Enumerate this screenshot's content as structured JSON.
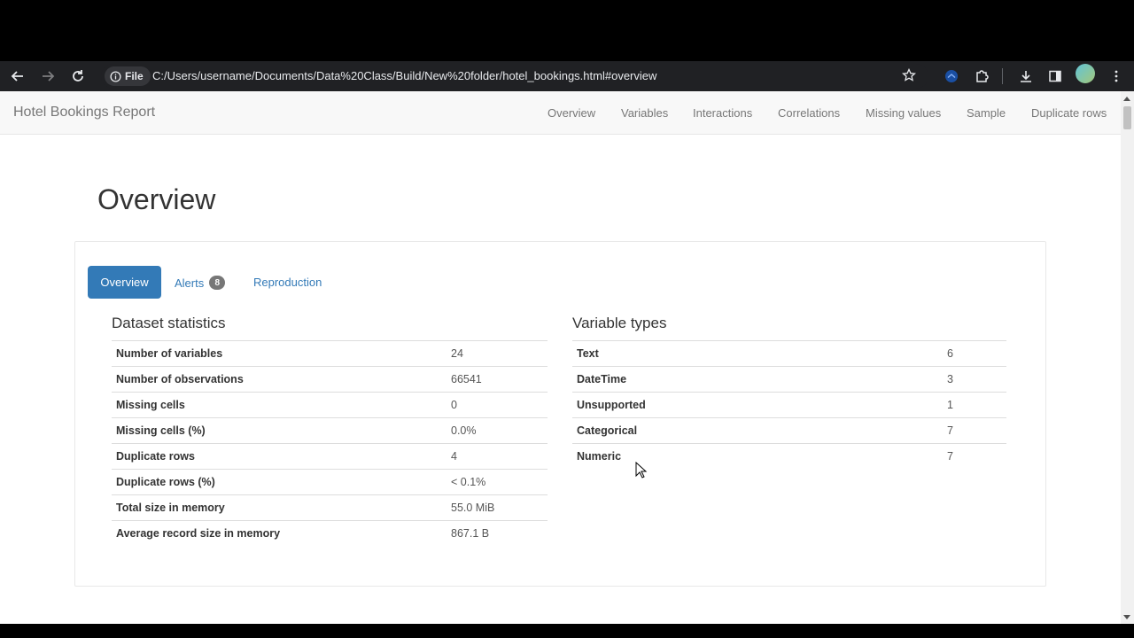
{
  "browser": {
    "file_chip_label": "File",
    "url": "C:/Users/username/Documents/Data%20Class/Build/New%20folder/hotel_bookings.html#overview"
  },
  "navbar": {
    "brand": "Hotel Bookings Report",
    "items": [
      "Overview",
      "Variables",
      "Interactions",
      "Correlations",
      "Missing values",
      "Sample",
      "Duplicate rows"
    ]
  },
  "page_title": "Overview",
  "tabs": {
    "overview": "Overview",
    "alerts": "Alerts",
    "alerts_count": "8",
    "reproduction": "Reproduction"
  },
  "dataset_statistics": {
    "title": "Dataset statistics",
    "rows": [
      {
        "label": "Number of variables",
        "value": "24"
      },
      {
        "label": "Number of observations",
        "value": "66541"
      },
      {
        "label": "Missing cells",
        "value": "0"
      },
      {
        "label": "Missing cells (%)",
        "value": "0.0%"
      },
      {
        "label": "Duplicate rows",
        "value": "4"
      },
      {
        "label": "Duplicate rows (%)",
        "value": "< 0.1%"
      },
      {
        "label": "Total size in memory",
        "value": "55.0 MiB"
      },
      {
        "label": "Average record size in memory",
        "value": "867.1 B"
      }
    ]
  },
  "variable_types": {
    "title": "Variable types",
    "rows": [
      {
        "label": "Text",
        "value": "6"
      },
      {
        "label": "DateTime",
        "value": "3"
      },
      {
        "label": "Unsupported",
        "value": "1"
      },
      {
        "label": "Categorical",
        "value": "7"
      },
      {
        "label": "Numeric",
        "value": "7"
      }
    ]
  },
  "colors": {
    "accent": "#337ab7",
    "browser_chrome": "#202124",
    "navbar_bg": "#f8f8f8"
  }
}
